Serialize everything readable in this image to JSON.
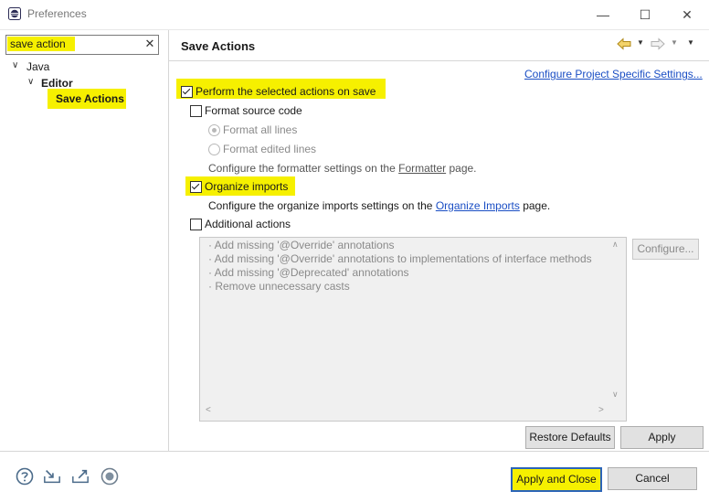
{
  "window": {
    "title": "Preferences",
    "minimize_glyph": "—",
    "maximize_glyph": "☐",
    "close_glyph": "✕"
  },
  "search": {
    "value": "save action",
    "clear_glyph": "✕"
  },
  "tree": {
    "java": {
      "label": "Java",
      "arrow": "∨"
    },
    "editor": {
      "label": "Editor",
      "arrow": "∨"
    },
    "save_actions": {
      "label": "Save Actions"
    }
  },
  "page": {
    "title": "Save Actions",
    "config_project_link": "Configure Project Specific Settings...",
    "perform_label": "Perform the selected actions on save",
    "format_source_label": "Format source code",
    "format_all_label": "Format all lines",
    "format_edited_label": "Format edited lines",
    "formatter_text_before": "Configure the formatter settings on the ",
    "formatter_link": "Formatter",
    "formatter_text_after": " page.",
    "organize_label": "Organize imports",
    "organize_text_before": "Configure the organize imports settings on the ",
    "organize_link": "Organize Imports",
    "organize_text_after": " page.",
    "additional_label": "Additional actions",
    "additional_items": [
      "· Add missing '@Override' annotations",
      "· Add missing '@Override' annotations to implementations of interface methods",
      "· Add missing '@Deprecated' annotations",
      "· Remove unnecessary casts"
    ],
    "configure_button": "Configure...",
    "restore_defaults_button": "Restore Defaults",
    "apply_button": "Apply"
  },
  "scroll": {
    "up": "∧",
    "down": "∨",
    "left": "<",
    "right": ">"
  },
  "nav": {
    "dropdown": "▼"
  },
  "footer": {
    "apply_close_button": "Apply and Close",
    "cancel_button": "Cancel"
  },
  "state": {
    "perform_checked": true,
    "format_source_checked": false,
    "format_all_selected": true,
    "organize_checked": true,
    "additional_checked": false
  },
  "icons": {
    "app": "eclipse-icon",
    "back": "back-arrow-icon",
    "forward": "forward-arrow-icon",
    "help": "help-icon",
    "import": "import-icon",
    "export": "export-icon",
    "record": "record-icon"
  },
  "colors": {
    "highlight": "#f6f000",
    "link": "#1a4ec4",
    "focus_border": "#2b64b8"
  }
}
